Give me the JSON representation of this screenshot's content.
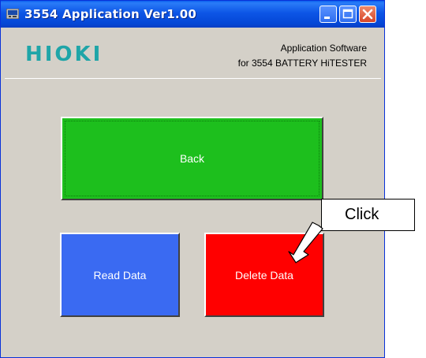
{
  "window": {
    "title": "3554 Application   Ver1.00",
    "controls": {
      "minimize": "minimize",
      "maximize": "maximize",
      "close": "close"
    }
  },
  "header": {
    "logo": "HIOKI",
    "subtitle_line1": "Application Software",
    "subtitle_line2": "for 3554 BATTERY HiTESTER"
  },
  "buttons": {
    "back": "Back",
    "read_data": "Read Data",
    "delete_data": "Delete Data"
  },
  "annotation": {
    "callout": "Click"
  },
  "colors": {
    "back": "#1dbf1d",
    "read_data": "#3a6af2",
    "delete_data": "#ff0000",
    "logo": "#1fa5a8",
    "window_bg": "#d4d0c8"
  }
}
